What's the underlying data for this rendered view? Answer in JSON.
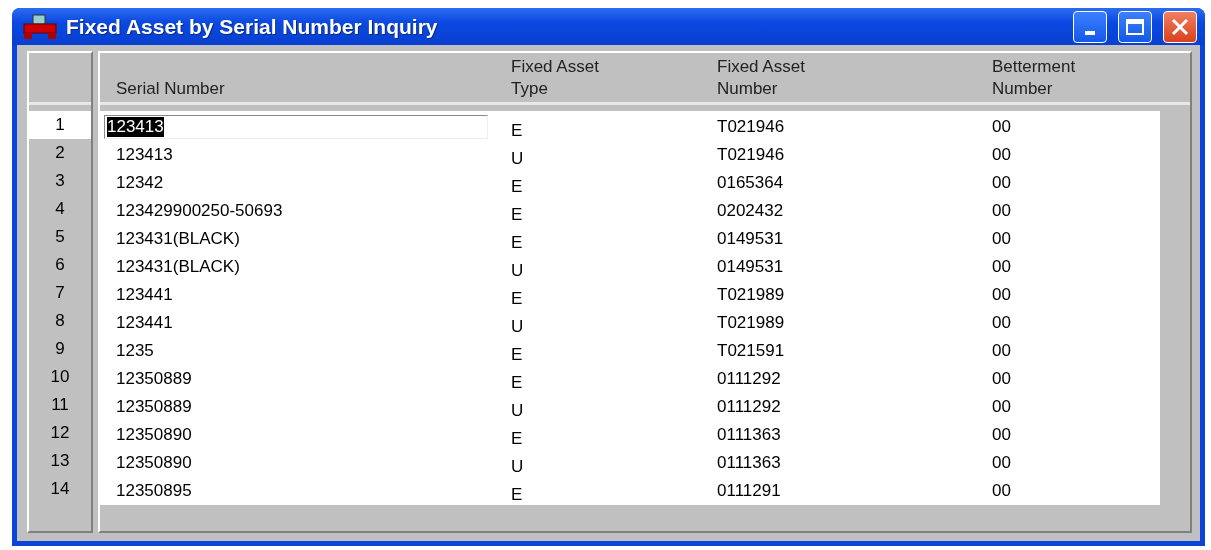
{
  "window": {
    "title": "Fixed Asset by Serial Number Inquiry"
  },
  "table": {
    "columns": [
      "Serial Number",
      "Fixed Asset\nType",
      "Fixed Asset\nNumber",
      "Betterment\nNumber"
    ],
    "rows": [
      {
        "row_number": "1",
        "serial_number": "123413",
        "type": "E",
        "asset_number": "T021946",
        "betterment": "00",
        "selected": true
      },
      {
        "row_number": "2",
        "serial_number": "123413",
        "type": "U",
        "asset_number": "T021946",
        "betterment": "00",
        "selected": false
      },
      {
        "row_number": "3",
        "serial_number": "12342",
        "type": "E",
        "asset_number": "0165364",
        "betterment": "00",
        "selected": false
      },
      {
        "row_number": "4",
        "serial_number": "123429900250-50693",
        "type": "E",
        "asset_number": "0202432",
        "betterment": "00",
        "selected": false
      },
      {
        "row_number": "5",
        "serial_number": "123431(BLACK)",
        "type": "E",
        "asset_number": "0149531",
        "betterment": "00",
        "selected": false
      },
      {
        "row_number": "6",
        "serial_number": "123431(BLACK)",
        "type": "U",
        "asset_number": "0149531",
        "betterment": "00",
        "selected": false
      },
      {
        "row_number": "7",
        "serial_number": "123441",
        "type": "E",
        "asset_number": "T021989",
        "betterment": "00",
        "selected": false
      },
      {
        "row_number": "8",
        "serial_number": "123441",
        "type": "U",
        "asset_number": "T021989",
        "betterment": "00",
        "selected": false
      },
      {
        "row_number": "9",
        "serial_number": "1235",
        "type": "E",
        "asset_number": "T021591",
        "betterment": "00",
        "selected": false
      },
      {
        "row_number": "10",
        "serial_number": "12350889",
        "type": "E",
        "asset_number": "0111292",
        "betterment": "00",
        "selected": false
      },
      {
        "row_number": "11",
        "serial_number": "12350889",
        "type": "U",
        "asset_number": "0111292",
        "betterment": "00",
        "selected": false
      },
      {
        "row_number": "12",
        "serial_number": "12350890",
        "type": "E",
        "asset_number": "0111363",
        "betterment": "00",
        "selected": false
      },
      {
        "row_number": "13",
        "serial_number": "12350890",
        "type": "U",
        "asset_number": "0111363",
        "betterment": "00",
        "selected": false
      },
      {
        "row_number": "14",
        "serial_number": "12350895",
        "type": "E",
        "asset_number": "0111291",
        "betterment": "00",
        "selected": false
      }
    ]
  }
}
